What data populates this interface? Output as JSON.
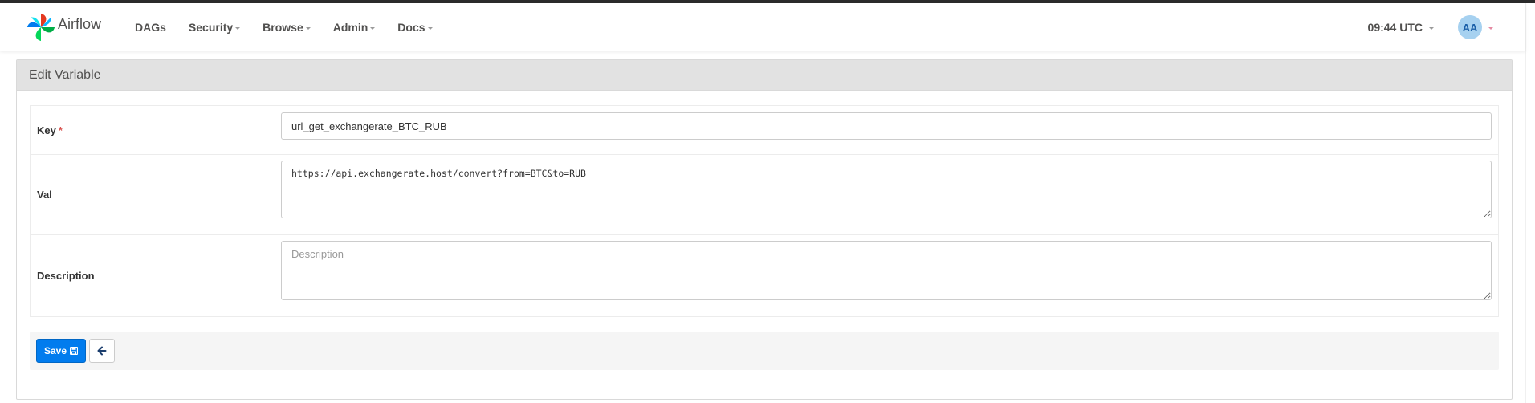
{
  "app": {
    "name": "Airflow",
    "logo_icon": "airflow-pinwheel-icon",
    "colors": {
      "accent": "#017cee",
      "required": "#d9534f",
      "avatar_bg": "#a6d1f0",
      "avatar_text": "#1a5fa8"
    }
  },
  "nav": {
    "items": [
      {
        "label": "DAGs",
        "has_dropdown": false
      },
      {
        "label": "Security",
        "has_dropdown": true
      },
      {
        "label": "Browse",
        "has_dropdown": true
      },
      {
        "label": "Admin",
        "has_dropdown": true
      },
      {
        "label": "Docs",
        "has_dropdown": true
      }
    ],
    "clock": "09:44 UTC",
    "avatar_initials": "AA"
  },
  "panel": {
    "title": "Edit Variable"
  },
  "form": {
    "key": {
      "label": "Key",
      "required_marker": "*",
      "value": "url_get_exchangerate_BTC_RUB"
    },
    "val": {
      "label": "Val",
      "value": "https://api.exchangerate.host/convert?from=BTC&to=RUB"
    },
    "description": {
      "label": "Description",
      "value": "",
      "placeholder": "Description"
    }
  },
  "actions": {
    "save_label": "Save",
    "save_icon": "floppy-disk-icon",
    "back_icon": "arrow-left-icon"
  }
}
